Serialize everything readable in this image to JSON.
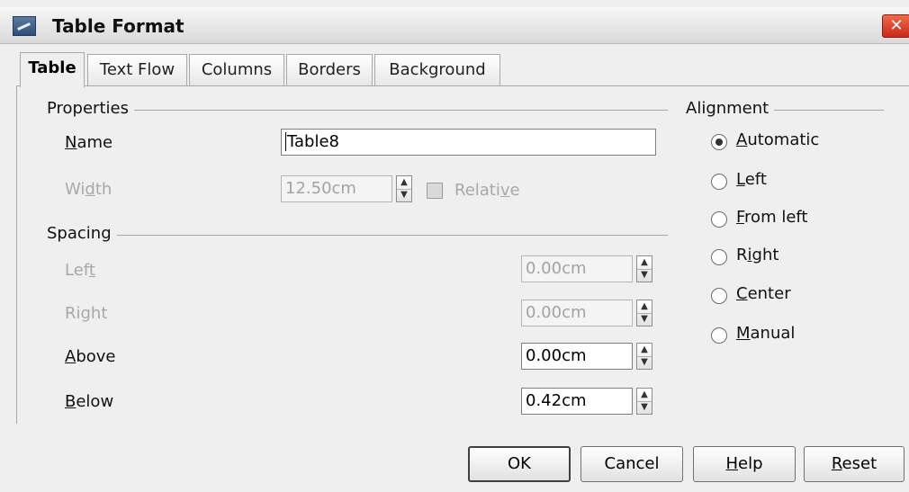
{
  "window": {
    "title": "Table Format",
    "close_glyph": "✕",
    "icon": "app-icon"
  },
  "tabs": [
    {
      "label": "Table",
      "active": true
    },
    {
      "label": "Text Flow",
      "active": false
    },
    {
      "label": "Columns",
      "active": false
    },
    {
      "label": "Borders",
      "active": false
    },
    {
      "label": "Background",
      "active": false
    }
  ],
  "properties": {
    "group_label": "Properties",
    "name_label_pre": "",
    "name_label_mn": "N",
    "name_label_post": "ame",
    "name_value": "Table8",
    "width_label_pre": "Wi",
    "width_label_mn": "d",
    "width_label_post": "th",
    "width_value": "12.50cm",
    "relative_label_pre": "Relati",
    "relative_label_mn": "v",
    "relative_label_post": "e",
    "relative_checked": false
  },
  "spacing": {
    "group_label": "Spacing",
    "left_label_pre": "Lef",
    "left_label_mn": "t",
    "left_value": "0.00cm",
    "right_label": "Right",
    "right_value": "0.00cm",
    "above_label_mn": "A",
    "above_label_post": "bove",
    "above_value": "0.00cm",
    "below_label_mn": "B",
    "below_label_post": "elow",
    "below_value": "0.42cm"
  },
  "alignment": {
    "group_label": "Alignment",
    "options": [
      {
        "pre": "",
        "mn": "A",
        "post": "utomatic",
        "checked": true
      },
      {
        "pre": "",
        "mn": "L",
        "post": "eft",
        "checked": false
      },
      {
        "pre": "",
        "mn": "F",
        "post": "rom left",
        "checked": false
      },
      {
        "pre": "R",
        "mn": "i",
        "post": "ght",
        "checked": false
      },
      {
        "pre": "",
        "mn": "C",
        "post": "enter",
        "checked": false
      },
      {
        "pre": "",
        "mn": "M",
        "post": "anual",
        "checked": false
      }
    ]
  },
  "buttons": {
    "ok": "OK",
    "cancel": "Cancel",
    "help_mn": "H",
    "help_post": "elp",
    "reset_mn": "R",
    "reset_post": "eset"
  }
}
